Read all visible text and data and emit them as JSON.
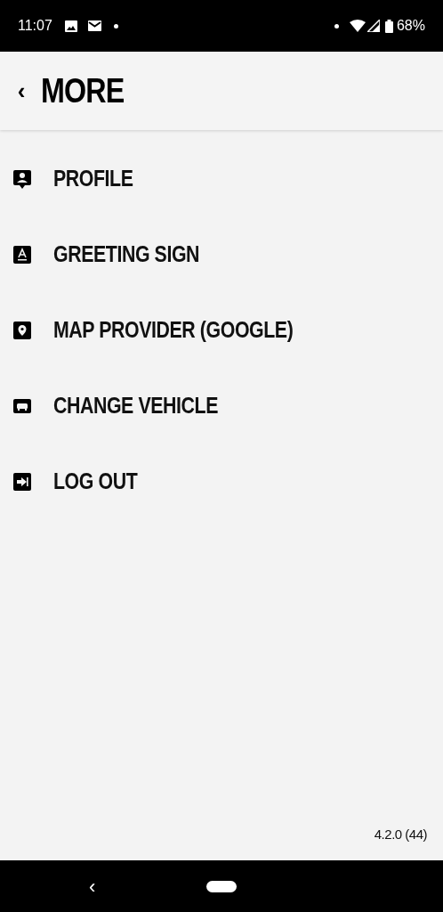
{
  "status_bar": {
    "time": "11:07",
    "battery": "68%"
  },
  "header": {
    "back": "‹",
    "title": "MORE"
  },
  "menu": [
    {
      "kind": "profile",
      "label": "PROFILE"
    },
    {
      "kind": "sign",
      "label": "GREETING SIGN"
    },
    {
      "kind": "map",
      "label": "MAP PROVIDER (GOOGLE)"
    },
    {
      "kind": "vehicle",
      "label": "CHANGE VEHICLE"
    },
    {
      "kind": "logout",
      "label": "LOG OUT"
    }
  ],
  "version": "4.2.0 (44)",
  "nav_bar": {
    "back": "‹"
  }
}
